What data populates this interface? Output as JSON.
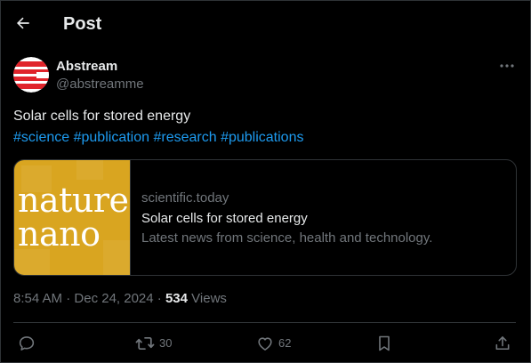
{
  "header": {
    "title": "Post",
    "back_icon": "arrow-left-icon"
  },
  "author": {
    "display_name": "Abstream",
    "handle": "@abstreamme",
    "avatar": "red-white-striped-logo",
    "more_icon": "more-horizontal-icon"
  },
  "post": {
    "text": "Solar cells for stored energy",
    "hashtags": [
      "#science",
      "#publication",
      "#research",
      "#publications"
    ]
  },
  "link_card": {
    "thumbnail_logo_lines": [
      "nature",
      "nano"
    ],
    "domain": "scientific.today",
    "title": "Solar cells for stored energy",
    "description": "Latest news from science, health and technology."
  },
  "meta": {
    "time": "8:54 AM",
    "separator": "·",
    "date": "Dec 24, 2024",
    "views_count": "534",
    "views_label": "Views"
  },
  "actions": {
    "reply_icon": "reply-icon",
    "repost_icon": "repost-icon",
    "repost_count": "30",
    "like_icon": "heart-icon",
    "like_count": "62",
    "bookmark_icon": "bookmark-icon",
    "share_icon": "share-icon"
  },
  "colors": {
    "background": "#000000",
    "text_primary": "#e7e9ea",
    "text_secondary": "#71767b",
    "link": "#1d9bf0",
    "border": "#2f3336",
    "thumbnail_bg": "#d9a520",
    "avatar_red": "#e0242b"
  }
}
